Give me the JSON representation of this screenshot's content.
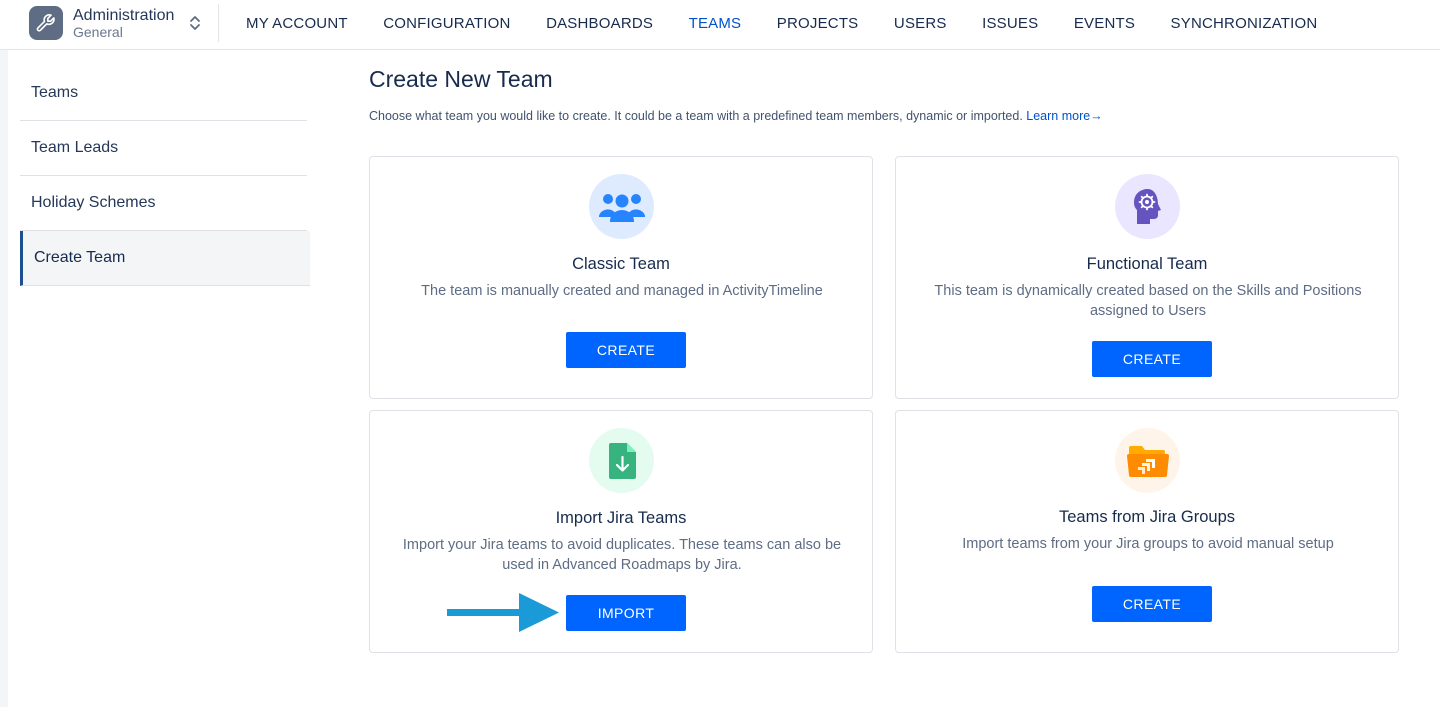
{
  "app": {
    "title": "Administration",
    "subtitle": "General",
    "logo_icon": "wrench-icon",
    "switch_icon": "chevron-updown-icon"
  },
  "nav": {
    "items": [
      {
        "label": "MY ACCOUNT",
        "active": false
      },
      {
        "label": "CONFIGURATION",
        "active": false
      },
      {
        "label": "DASHBOARDS",
        "active": false
      },
      {
        "label": "TEAMS",
        "active": true
      },
      {
        "label": "PROJECTS",
        "active": false
      },
      {
        "label": "USERS",
        "active": false
      },
      {
        "label": "ISSUES",
        "active": false
      },
      {
        "label": "EVENTS",
        "active": false
      },
      {
        "label": "SYNCHRONIZATION",
        "active": false
      }
    ]
  },
  "sidebar": {
    "items": [
      {
        "label": "Teams",
        "active": false
      },
      {
        "label": "Team Leads",
        "active": false
      },
      {
        "label": "Holiday Schemes",
        "active": false
      },
      {
        "label": "Create Team",
        "active": true
      }
    ]
  },
  "main": {
    "title": "Create New Team",
    "description": "Choose what team you would like to create. It could be a team with a predefined team members, dynamic or imported. ",
    "learn_more": "Learn more→"
  },
  "cards": [
    {
      "title": "Classic Team",
      "description": "The team is manually created and managed in ActivityTimeline",
      "button": "CREATE",
      "icon": "users-group-icon",
      "icon_bg": "#deebff",
      "icon_color": "#2684ff"
    },
    {
      "title": "Functional Team",
      "description": "This team is dynamically created based on the Skills and Positions assigned to Users",
      "button": "CREATE",
      "icon": "head-gear-icon",
      "icon_bg": "#eae6ff",
      "icon_color": "#6554c0"
    },
    {
      "title": "Import Jira Teams",
      "description": "Import your Jira teams to avoid duplicates. These teams can also be used in Advanced Roadmaps by Jira.",
      "button": "IMPORT",
      "icon": "file-download-icon",
      "icon_bg": "#e3fcef",
      "icon_color": "#36b37e"
    },
    {
      "title": "Teams from Jira Groups",
      "description": "Import teams from your Jira groups to avoid manual setup",
      "button": "CREATE",
      "icon": "jira-folder-icon",
      "icon_bg": "#fff4ea",
      "icon_color": "#ff8b00"
    }
  ],
  "annotation": {
    "icon": "arrow-right-icon",
    "color": "#1a9bd7"
  }
}
